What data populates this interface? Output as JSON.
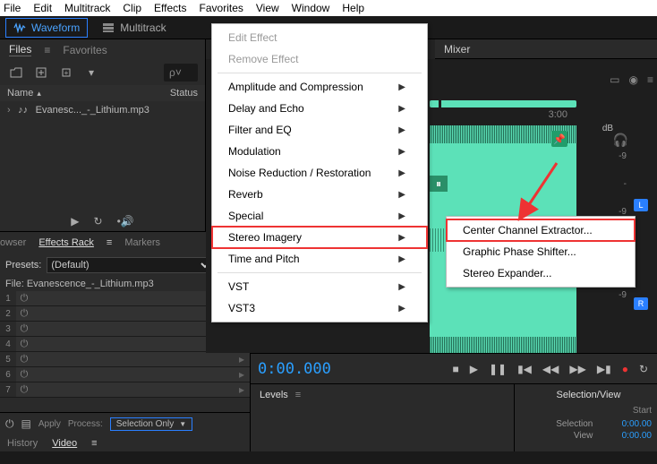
{
  "menubar": [
    "File",
    "Edit",
    "Multitrack",
    "Clip",
    "Effects",
    "Favorites",
    "View",
    "Window",
    "Help"
  ],
  "viewbar": {
    "waveform": "Waveform",
    "multitrack": "Multitrack"
  },
  "files_panel": {
    "tab_files": "Files",
    "tab_favorites": "Favorites",
    "search_sigil": "ρ˅",
    "header_name": "Name",
    "header_status": "Status",
    "file1": "Evanesc..._-_Lithium.mp3"
  },
  "fx_panel": {
    "tab_browser": "owser",
    "tab_rack": "Effects Rack",
    "tab_markers": "Markers",
    "presets_label": "Presets:",
    "preset_value": "(Default)",
    "file_label": "File: Evanescence_-_Lithium.mp3",
    "slots": [
      "1",
      "2",
      "3",
      "4",
      "5",
      "6",
      "7"
    ],
    "apply": "Apply",
    "process": "Process:",
    "process_value": "Selection Only",
    "history": "History",
    "video": "Video"
  },
  "mixer_label": "Mixer",
  "timeline_tick": "3:00",
  "timecode": "0:00.000",
  "db": {
    "hdr": "dB",
    "vals": [
      "",
      "-9",
      "-",
      "-9",
      "",
      "-9",
      "-",
      "-9"
    ]
  },
  "ch": {
    "L": "L",
    "R": "R"
  },
  "levels_label": "Levels",
  "selview": {
    "hdr": "Selection/View",
    "start": "Start",
    "selection": "Selection",
    "view": "View",
    "sel_val": "0:00.00",
    "view_val": "0:00.00"
  },
  "effects_menu": {
    "edit_effect": "Edit Effect",
    "remove_effect": "Remove Effect",
    "items": [
      "Amplitude and Compression",
      "Delay and Echo",
      "Filter and EQ",
      "Modulation",
      "Noise Reduction / Restoration",
      "Reverb",
      "Special",
      "Stereo Imagery",
      "Time and Pitch"
    ],
    "vst": "VST",
    "vst3": "VST3"
  },
  "stereo_submenu": {
    "center": "Center Channel Extractor...",
    "graphic": "Graphic Phase Shifter...",
    "expander": "Stereo Expander..."
  }
}
